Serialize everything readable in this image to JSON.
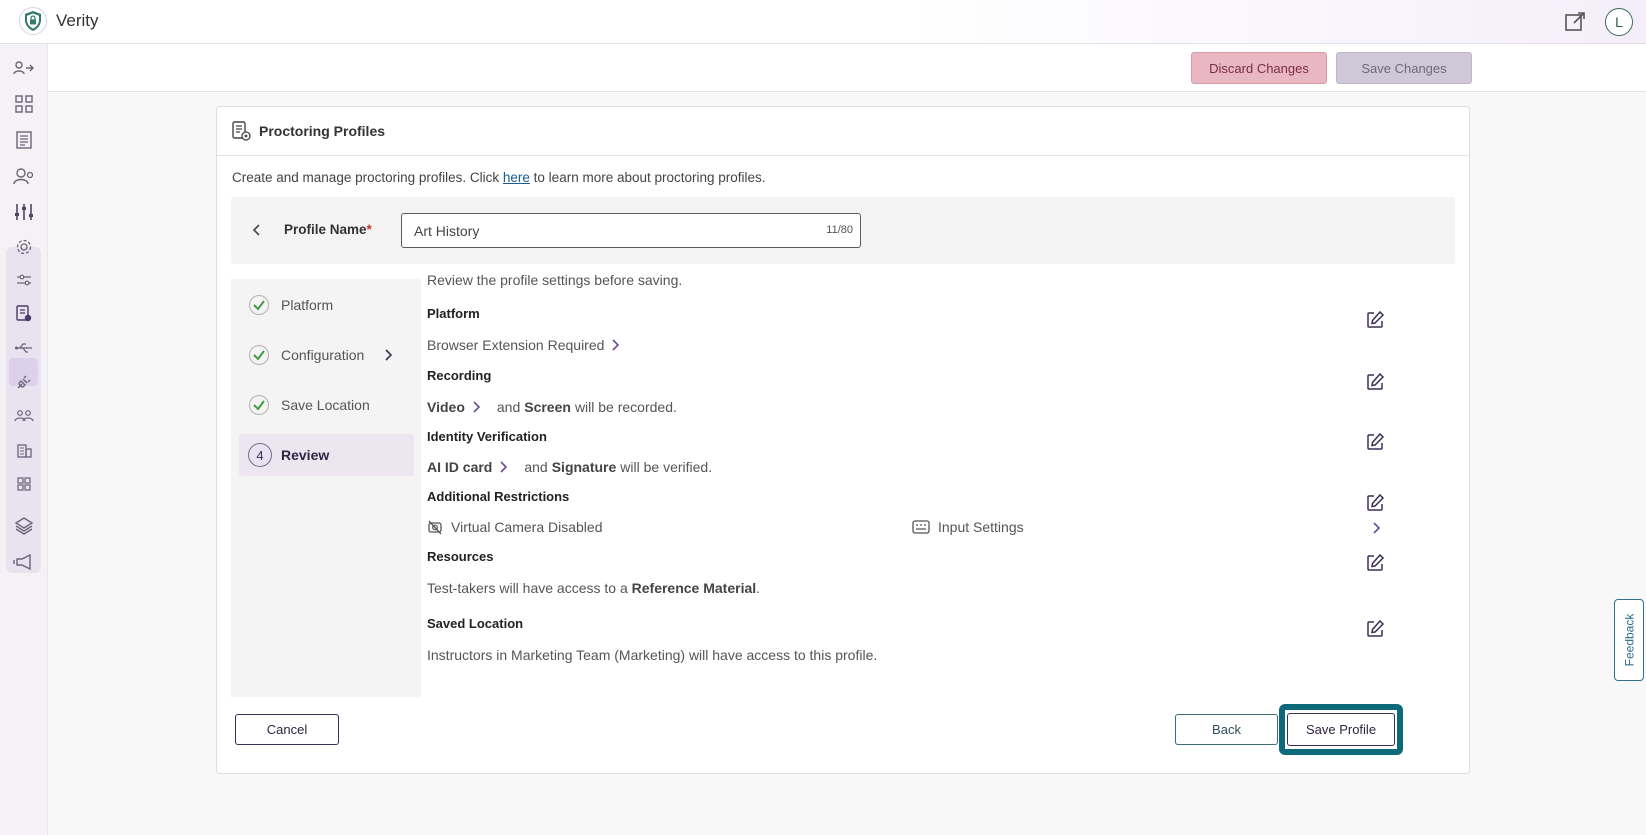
{
  "app": {
    "title": "Verity"
  },
  "header": {
    "avatar_initial": "L",
    "external_link_icon": "external-link-icon"
  },
  "rail": {
    "items": [
      "login-icon",
      "dashboard-icon",
      "reports-icon",
      "user-search-icon",
      "sliders-icon",
      "gear-icon",
      "tune-icon",
      "profile-doc-icon",
      "usb-icon",
      "plug-icon",
      "users-icon",
      "building-icon",
      "apps-icon",
      "layers-icon",
      "announce-icon"
    ]
  },
  "actions": {
    "discard": "Discard Changes",
    "save_changes": "Save Changes"
  },
  "card": {
    "title": "Proctoring Profiles",
    "intro_before": "Create and manage proctoring profiles. Click ",
    "intro_link": "here",
    "intro_after": " to learn more about proctoring profiles."
  },
  "profile": {
    "label": "Profile Name",
    "required_mark": "*",
    "value": "Art History",
    "counter": "11/80"
  },
  "steps": [
    {
      "label": "Platform",
      "state": "done"
    },
    {
      "label": "Configuration",
      "state": "done"
    },
    {
      "label": "Save Location",
      "state": "done"
    },
    {
      "label": "Review",
      "state": "active",
      "number": "4"
    }
  ],
  "review": {
    "intro": "Review the profile settings before saving.",
    "platform": {
      "heading": "Platform",
      "text": "Browser Extension Required"
    },
    "recording": {
      "heading": "Recording",
      "item1": "Video",
      "mid": "and",
      "item2": "Screen",
      "tail": "will be recorded."
    },
    "identity": {
      "heading": "Identity Verification",
      "item1": "AI ID card",
      "mid": "and",
      "item2": "Signature",
      "tail": "will be verified."
    },
    "restrictions": {
      "heading": "Additional Restrictions",
      "item1": "Virtual Camera Disabled",
      "item2": "Input Settings"
    },
    "resources": {
      "heading": "Resources",
      "before": "Test-takers will have access to a ",
      "bold": "Reference Material",
      "after": "."
    },
    "saved_location": {
      "heading": "Saved Location",
      "text": "Instructors in Marketing Team (Marketing) will have access to this profile."
    }
  },
  "footer": {
    "cancel": "Cancel",
    "back": "Back",
    "save_profile": "Save Profile"
  },
  "feedback": "Feedback",
  "colors": {
    "accent": "#3d2e55",
    "focus_ring": "#0e6a7a",
    "discard_bg": "#e9b6c4",
    "check_green": "#3f9b45"
  }
}
